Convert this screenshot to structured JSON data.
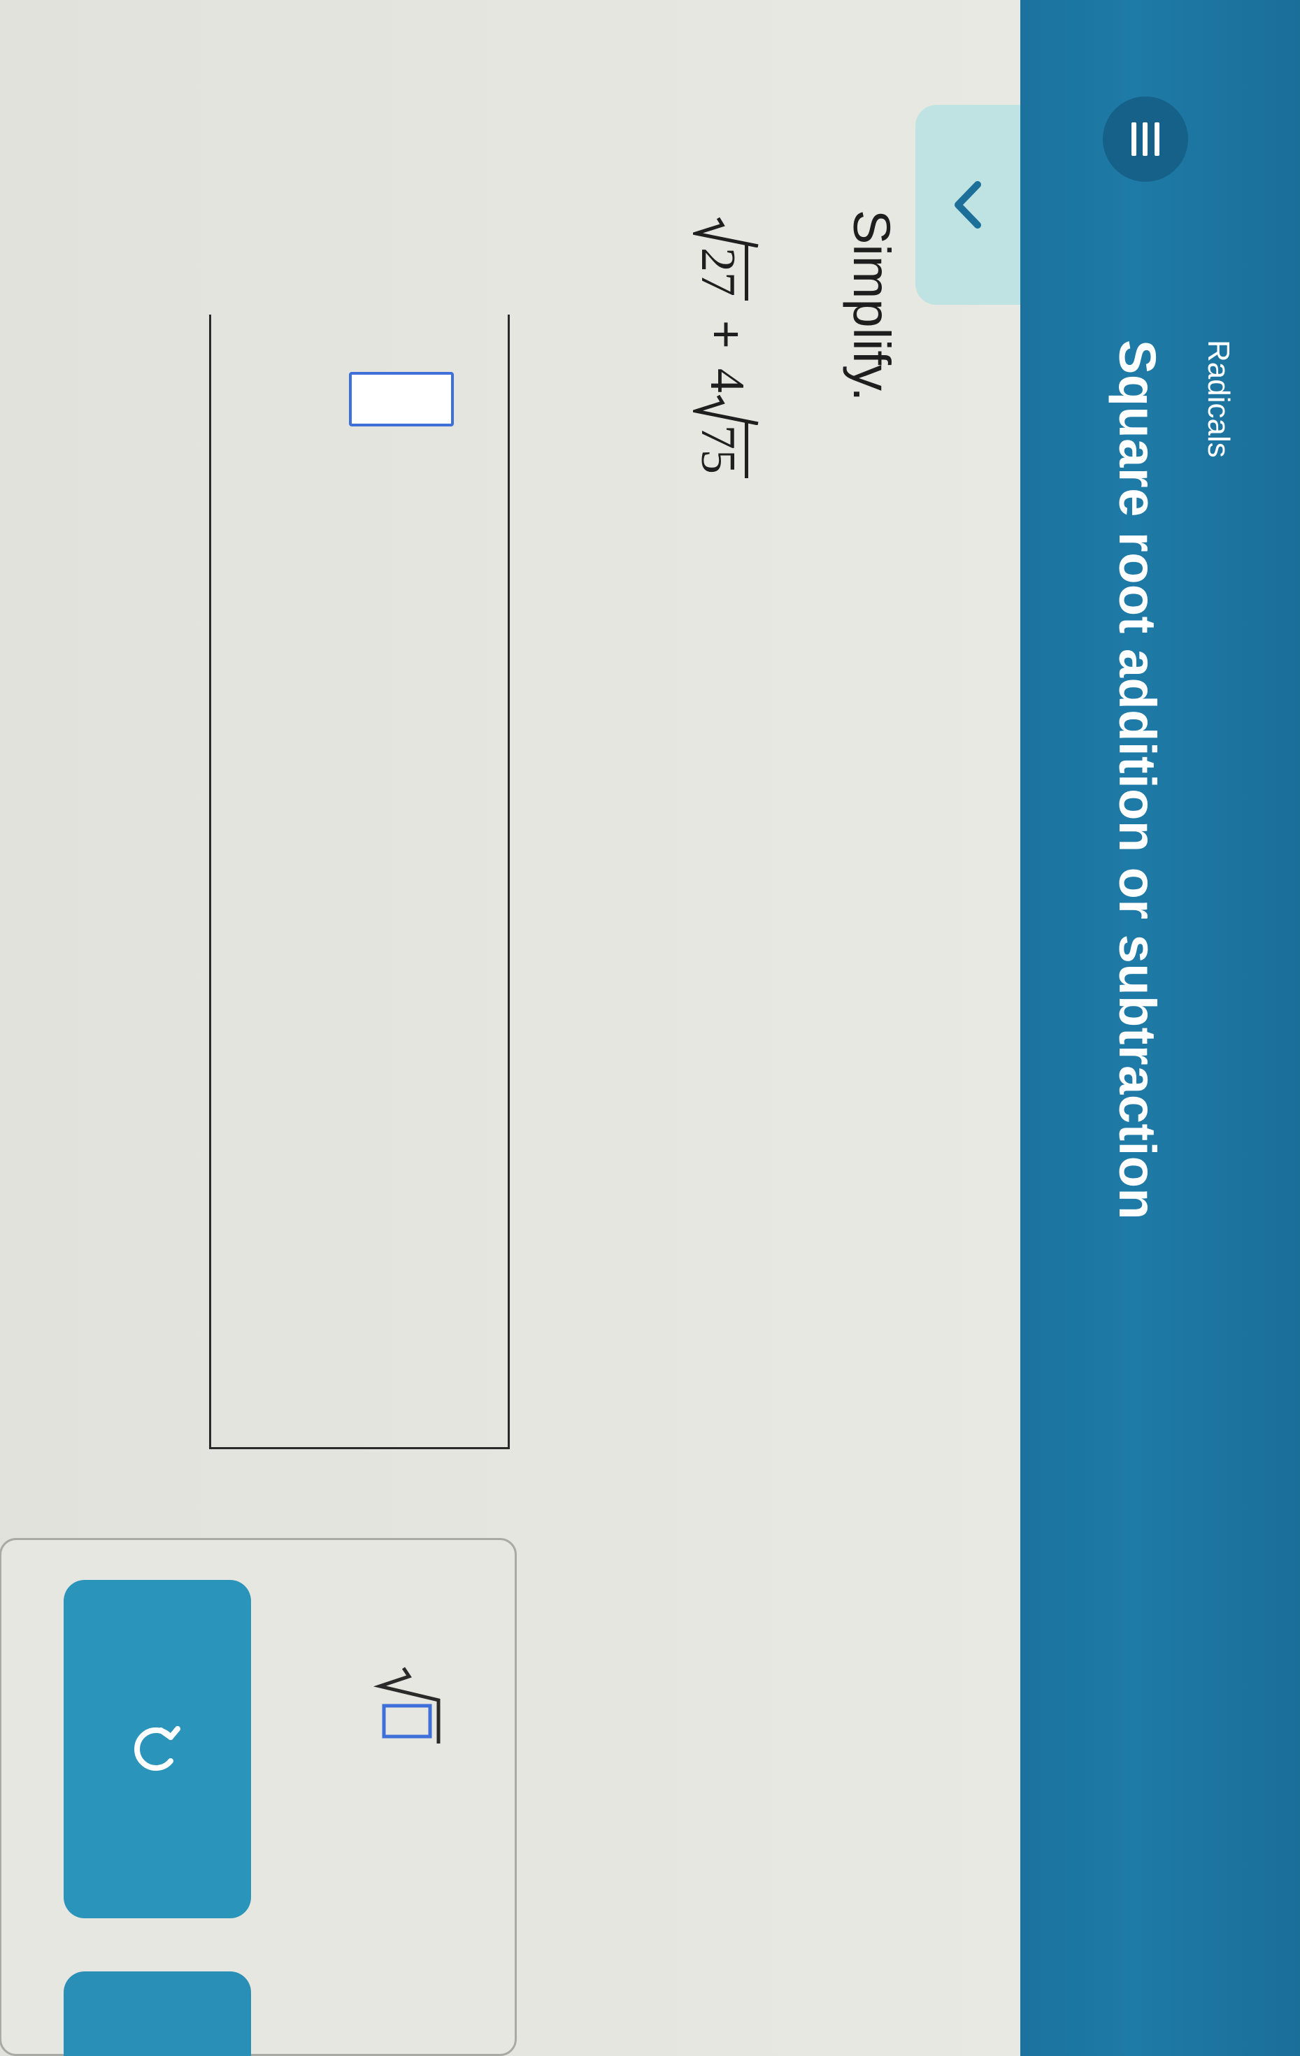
{
  "header": {
    "topic": "Radicals",
    "lesson_title": "Square root addition or subtraction",
    "menu_icon": "hamburger-menu-icon",
    "collapse_icon": "chevron-down-icon",
    "accent_color": "#1e7aa6"
  },
  "problem": {
    "prompt": "Simplify.",
    "term1_radicand": "27",
    "operator": "+",
    "term2_coefficient": "4",
    "term2_radicand": "75"
  },
  "answer": {
    "value": ""
  },
  "keypad": {
    "sqrt_key_icon": "square-root-icon",
    "undo_icon": "undo-icon",
    "button_color": "#2b94bb"
  }
}
